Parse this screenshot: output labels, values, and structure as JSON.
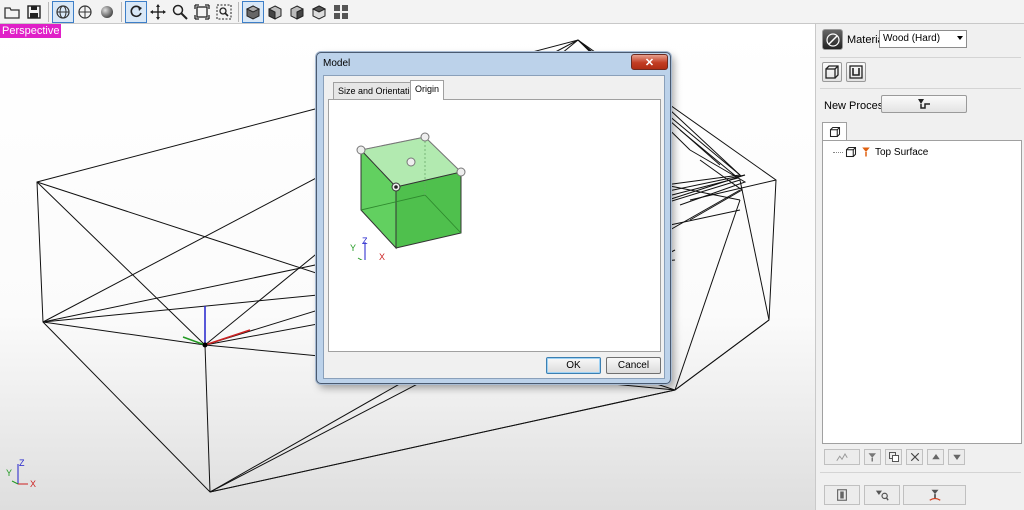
{
  "toolbar": {
    "buttons": [
      "open-icon",
      "save-icon",
      "wireframe-view-icon",
      "globe-view-icon",
      "sphere-shade-icon",
      "rotate-icon",
      "pan-icon",
      "zoom-icon",
      "zoom-extents-icon",
      "zoom-window-icon",
      "view-iso-icon",
      "view-front-icon",
      "view-right-icon",
      "view-top-icon",
      "view-grid-icon"
    ]
  },
  "viewport": {
    "label": "Perspective",
    "label_color": "#e020c8",
    "axis_labels": {
      "y": "Y",
      "z": "Z",
      "x": "X"
    },
    "axis_colors": {
      "x": "#cc2222",
      "y": "#229922",
      "z": "#2222cc"
    }
  },
  "dialog": {
    "title": "Model",
    "close_glyph": "✕",
    "tabs": [
      {
        "label": "Size and Orientation",
        "active": false
      },
      {
        "label": "Origin",
        "active": true
      }
    ],
    "axis_labels": {
      "y": "Y",
      "z": "Z",
      "x": "X"
    },
    "cube_color": "#62d060",
    "ok_label": "OK",
    "cancel_label": "Cancel"
  },
  "panel": {
    "material_label": "Material",
    "material_value": "Wood (Hard)",
    "new_process_label": "New Process",
    "tree": {
      "items": [
        {
          "label": "Top Surface"
        }
      ]
    }
  }
}
